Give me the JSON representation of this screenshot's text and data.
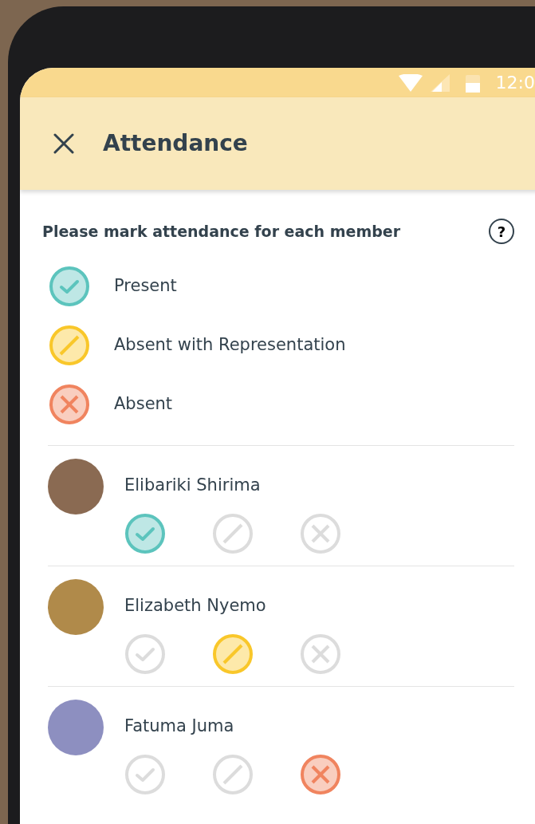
{
  "status_bar": {
    "time": "12:0"
  },
  "app_bar": {
    "title": "Attendance"
  },
  "instruction": {
    "text": "Please mark attendance for each member",
    "help": "?"
  },
  "legend": [
    {
      "kind": "present",
      "label": "Present",
      "color": "#5cc4bd"
    },
    {
      "kind": "excused",
      "label": "Absent with Representation",
      "color": "#f9c72a"
    },
    {
      "kind": "absent",
      "label": "Absent",
      "color": "#f0845f"
    }
  ],
  "members": [
    {
      "name": "Elibariki Shirima",
      "statuses": [
        {
          "kind": "present",
          "selected": true
        },
        {
          "kind": "excused",
          "selected": false
        },
        {
          "kind": "absent",
          "selected": false
        }
      ]
    },
    {
      "name": "Elizabeth Nyemo",
      "statuses": [
        {
          "kind": "present",
          "selected": false
        },
        {
          "kind": "excused",
          "selected": true
        },
        {
          "kind": "absent",
          "selected": false
        }
      ]
    },
    {
      "name": "Fatuma Juma",
      "statuses": [
        {
          "kind": "present",
          "selected": false
        },
        {
          "kind": "excused",
          "selected": false
        },
        {
          "kind": "absent",
          "selected": true
        }
      ]
    }
  ]
}
